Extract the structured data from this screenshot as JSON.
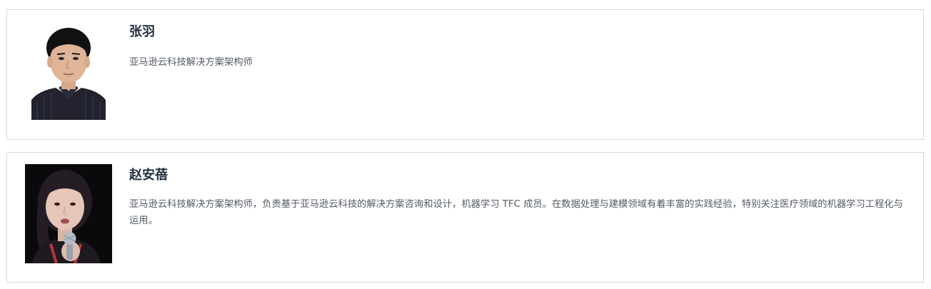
{
  "speakers": [
    {
      "name": "张羽",
      "bio": "亚马逊云科技解决方案架构师"
    },
    {
      "name": "赵安蓓",
      "bio": "亚马逊云科技解决方案架构师，负责基于亚马逊云科技的解决方案咨询和设计，机器学习 TFC 成员。在数据处理与建模领域有着丰富的实践经验，特别关注医疗领域的机器学习工程化与运用。"
    }
  ]
}
